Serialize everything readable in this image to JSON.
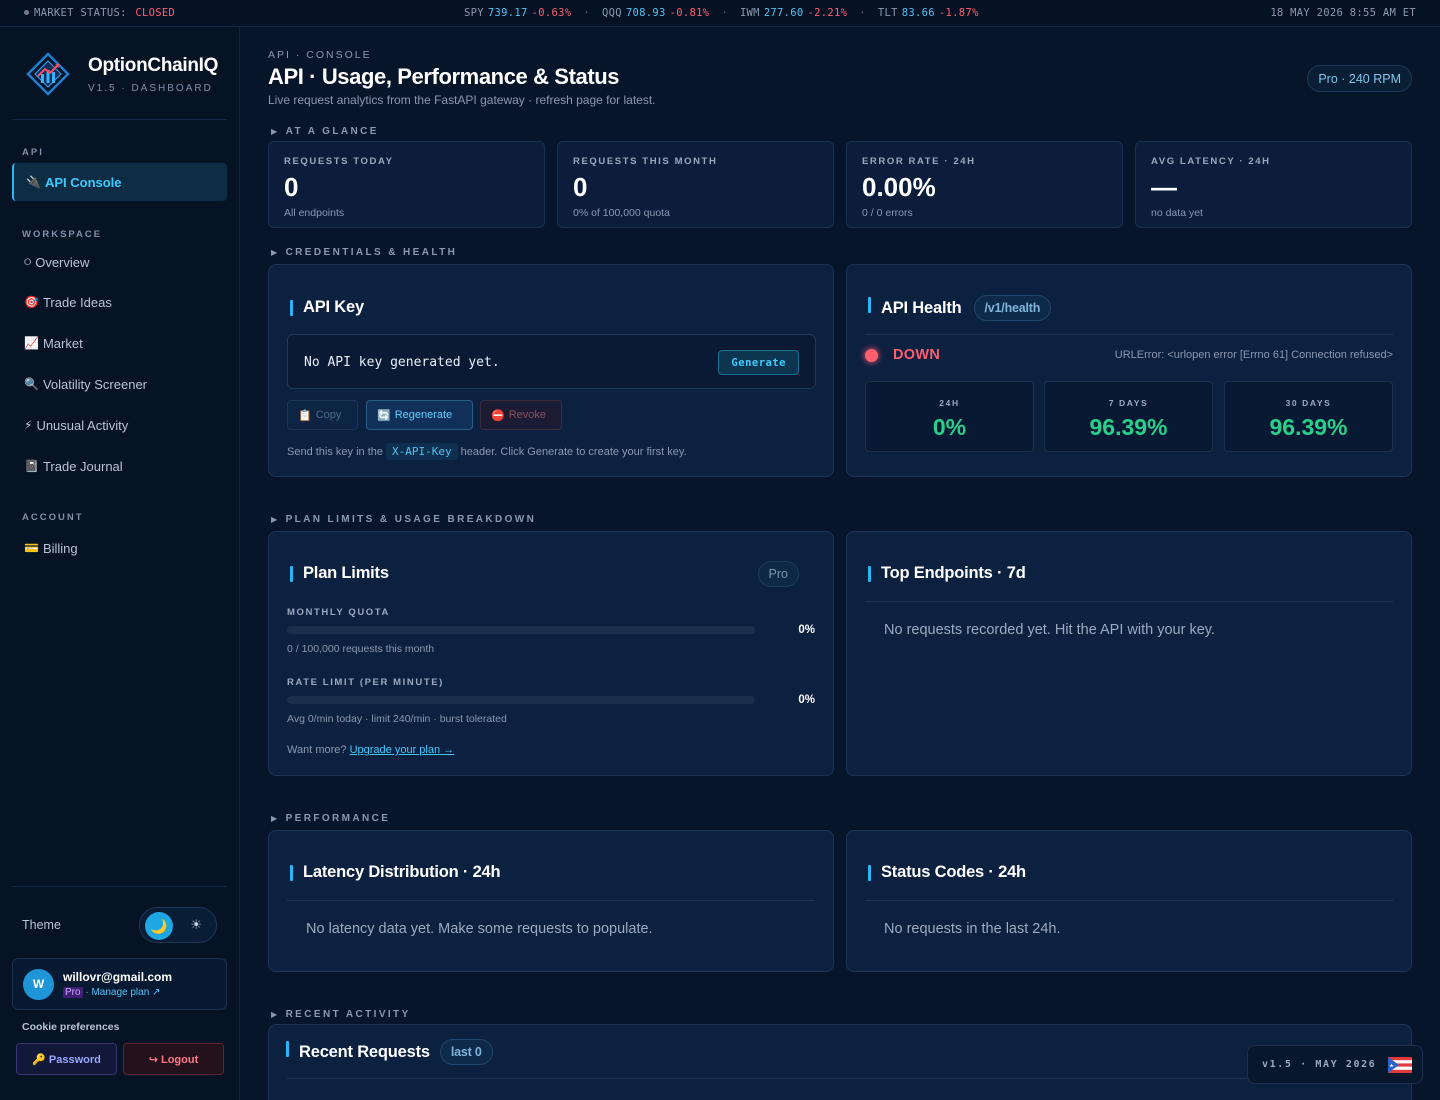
{
  "ticker": {
    "status_label": "MARKET STATUS:",
    "status_value": "CLOSED",
    "quotes": [
      {
        "symbol": "SPY",
        "price": "739.17",
        "change": "-0.63%"
      },
      {
        "symbol": "QQQ",
        "price": "708.93",
        "change": "-0.81%"
      },
      {
        "symbol": "IWM",
        "price": "277.60",
        "change": "-2.21%"
      },
      {
        "symbol": "TLT",
        "price": "83.66",
        "change": "-1.87%"
      }
    ],
    "separator": "·",
    "datetime": "18 MAY 2026 8:55 AM ET"
  },
  "brand": {
    "name": "OptionChainIQ",
    "subtitle": "V1.5 · DASHBOARD"
  },
  "sidebar": {
    "sections": {
      "api": "API",
      "workspace": "WORKSPACE",
      "account": "ACCOUNT"
    },
    "api_items": [
      {
        "icon": "🔌",
        "label": "API Console"
      }
    ],
    "workspace_items": [
      {
        "icon": "⭘",
        "label": "Overview"
      },
      {
        "icon": "🎯",
        "label": "Trade Ideas"
      },
      {
        "icon": "📈",
        "label": "Market"
      },
      {
        "icon": "🔍",
        "label": "Volatility Screener"
      },
      {
        "icon": "⚡",
        "label": "Unusual Activity"
      },
      {
        "icon": "📓",
        "label": "Trade Journal"
      }
    ],
    "account_items": [
      {
        "icon": "💳",
        "label": "Billing"
      }
    ],
    "theme_label": "Theme",
    "theme_moon": "🌙",
    "theme_sun": "☀",
    "user": {
      "initial": "W",
      "email": "willovr@gmail.com",
      "plan": "Pro",
      "manage": "· Manage plan ↗"
    },
    "cookie": "Cookie preferences",
    "password_btn": "🔑 Password",
    "logout_btn": "↪ Logout"
  },
  "header": {
    "eyebrow": "API · CONSOLE",
    "title": "API · Usage, Performance & Status",
    "subtitle": "Live request analytics from the FastAPI gateway · refresh page for latest.",
    "plan_pill": "Pro · 240 RPM"
  },
  "sections": {
    "glance": "AT A GLANCE",
    "credentials": "CREDENTIALS & HEALTH",
    "plan": "PLAN LIMITS & USAGE BREAKDOWN",
    "performance": "PERFORMANCE",
    "recent": "RECENT ACTIVITY"
  },
  "stats": [
    {
      "label": "REQUESTS TODAY",
      "value": "0",
      "sub": "All endpoints"
    },
    {
      "label": "REQUESTS THIS MONTH",
      "value": "0",
      "sub": "0% of 100,000 quota"
    },
    {
      "label": "ERROR RATE · 24H",
      "value": "0.00%",
      "sub": "0 / 0 errors"
    },
    {
      "label": "AVG LATENCY · 24H",
      "value": "—",
      "sub": "no data yet"
    }
  ],
  "api_key": {
    "title": "API Key",
    "message": "No API key generated yet.",
    "generate": "Generate",
    "copy": "Copy",
    "copy_icon": "📋",
    "regenerate": "Regenerate",
    "regenerate_icon": "🔄",
    "revoke": "Revoke",
    "revoke_icon": "⛔",
    "note_before": "Send this key in the",
    "note_code": "X-API-Key",
    "note_after": "header. Click Generate to create your first key."
  },
  "health": {
    "title": "API Health",
    "endpoint": "/v1/health",
    "state": "DOWN",
    "error": "URLError: <urlopen error [Errno 61] Connection refused>",
    "uptime": [
      {
        "label": "24H",
        "value": "0%"
      },
      {
        "label": "7 DAYS",
        "value": "96.39%"
      },
      {
        "label": "30 DAYS",
        "value": "96.39%"
      }
    ]
  },
  "plan_limits": {
    "title": "Plan Limits",
    "badge": "Pro",
    "quota_label": "MONTHLY QUOTA",
    "quota_pct": "0%",
    "quota_fill": 0,
    "quota_sub": "0 / 100,000 requests this month",
    "rate_label": "RATE LIMIT (PER MINUTE)",
    "rate_pct": "0%",
    "rate_fill": 0,
    "rate_sub": "Avg 0/min today · limit 240/min · burst tolerated",
    "upgrade_prefix": "Want more?",
    "upgrade_link": "Upgrade your plan →"
  },
  "top_endpoints": {
    "title": "Top Endpoints · 7d",
    "empty": "No requests recorded yet. Hit the API with your key."
  },
  "latency": {
    "title": "Latency Distribution · 24h",
    "empty": "No latency data yet. Make some requests to populate."
  },
  "status_codes": {
    "title": "Status Codes · 24h",
    "empty": "No requests in the last 24h."
  },
  "recent": {
    "title": "Recent Requests",
    "badge": "last 0"
  },
  "version_pill": "v1.5 · MAY 2026",
  "colors": {
    "accent": "#29b6f6",
    "down": "#ff5e6e",
    "uptime": "#29d08a"
  }
}
